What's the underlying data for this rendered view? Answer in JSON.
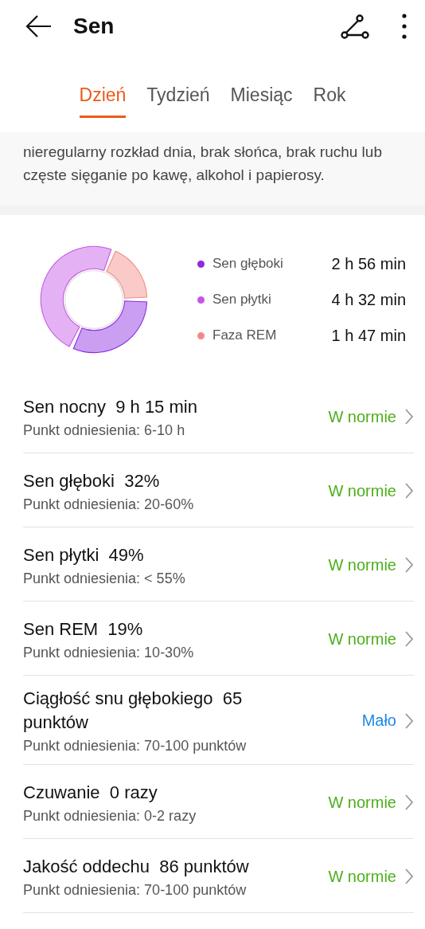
{
  "header": {
    "title": "Sen"
  },
  "tabs": [
    {
      "label": "Dzień",
      "selected": true
    },
    {
      "label": "Tydzień",
      "selected": false
    },
    {
      "label": "Miesiąc",
      "selected": false
    },
    {
      "label": "Rok",
      "selected": false
    }
  ],
  "intro": {
    "text": "nieregularny rozkład dnia, brak słońca, brak ruchu lub częste sięganie po kawę, alkohol i papierosy."
  },
  "summary": {
    "legend": [
      {
        "value": "2 h 56 min",
        "color": "#8a2be2"
      },
      {
        "value": "4 h 32 min",
        "color": "#c455e6"
      },
      {
        "value": "1 h 47 min",
        "color": "#f28a84"
      }
    ],
    "chart_data": {
      "type": "donut",
      "categories": [
        "Sen głęboki",
        "Sen płytki",
        "Faza REM"
      ],
      "values": [
        32,
        49,
        19
      ]
    }
  },
  "metrics": [
    {
      "title": "Sen nocny  9 h 15 min",
      "reference": "Punkt odniesienia: 6-10 h",
      "status": "W normie",
      "color": "#4caf1a"
    },
    {
      "title": "Sen głęboki  32%",
      "reference": "Punkt odniesienia: 20-60%",
      "status": "W normie",
      "color": "#4caf1a"
    },
    {
      "title": "Sen płytki  49%",
      "reference": "Punkt odniesienia: < 55%",
      "status": "W normie",
      "color": "#4caf1a"
    },
    {
      "title": "Sen REM  19%",
      "reference": "Punkt odniesienia: 10-30%",
      "status": "W normie",
      "color": "#4caf1a"
    },
    {
      "title": "Ciągłość snu głębokiego  65 punktów",
      "reference": "Punkt odniesienia: 70-100 punktów",
      "status": "Mało",
      "color": "#1e88e5"
    },
    {
      "title": "Czuwanie  0 razy",
      "reference": "Punkt odniesienia: 0-2 razy",
      "status": "W normie",
      "color": "#4caf1a"
    },
    {
      "title": "Jakość oddechu  86 punktów",
      "reference": "Punkt odniesienia: 70-100 punktów",
      "status": "W normie",
      "color": "#4caf1a"
    }
  ]
}
